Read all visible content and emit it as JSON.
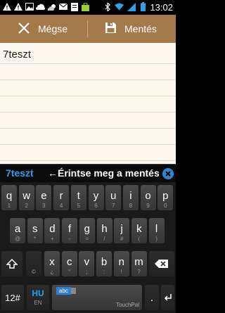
{
  "status_bar": {
    "time": "13:02",
    "left_icons": [
      "alert-icon",
      "alert-icon",
      "image-icon",
      "soundcloud-icon",
      "weather-icon",
      "mail-icon",
      "document-icon",
      "shopping-icon"
    ],
    "right_icons": [
      "bluetooth-icon",
      "wifi-icon",
      "signal-icon",
      "battery-icon"
    ]
  },
  "action_bar": {
    "cancel_label": "Mégse",
    "save_label": "Mentés"
  },
  "note": {
    "text": "7teszt"
  },
  "suggestion_bar": {
    "word": "7teszt",
    "hint": "←Érintse meg a mentés"
  },
  "keyboard": {
    "row1": [
      {
        "main": "q",
        "sub": "1"
      },
      {
        "main": "w",
        "sub": "2"
      },
      {
        "main": "e",
        "sub": "3"
      },
      {
        "main": "r",
        "sub": "4"
      },
      {
        "main": "t",
        "sub": "5"
      },
      {
        "main": "y",
        "sub": "6"
      },
      {
        "main": "u",
        "sub": "7"
      },
      {
        "main": "i",
        "sub": "8"
      },
      {
        "main": "o",
        "sub": "9"
      },
      {
        "main": "p",
        "sub": "0"
      }
    ],
    "row2": [
      {
        "main": "a",
        "sub": "@"
      },
      {
        "main": "s",
        "sub": "*"
      },
      {
        "main": "d",
        "sub": "+"
      },
      {
        "main": "f",
        "sub": "-"
      },
      {
        "main": "g",
        "sub": "="
      },
      {
        "main": "h",
        "sub": "/"
      },
      {
        "main": "j",
        "sub": "#"
      },
      {
        "main": "k",
        "sub": "("
      },
      {
        "main": "l",
        "sub": ")"
      }
    ],
    "row3": [
      {
        "main": "x",
        "sub": "¿"
      },
      {
        "main": "c",
        "sub": "\""
      },
      {
        "main": "v",
        "sub": ";"
      },
      {
        "main": "b",
        "sub": ":"
      },
      {
        "main": "n",
        "sub": "!"
      },
      {
        "main": "m",
        "sub": "?"
      }
    ],
    "row3_left_special": "©",
    "symbol_key": "12#",
    "lang_primary": "HU",
    "lang_secondary": "EN",
    "space_badge": "abc",
    "space_brand": "TouchPal",
    "period_key": "."
  }
}
